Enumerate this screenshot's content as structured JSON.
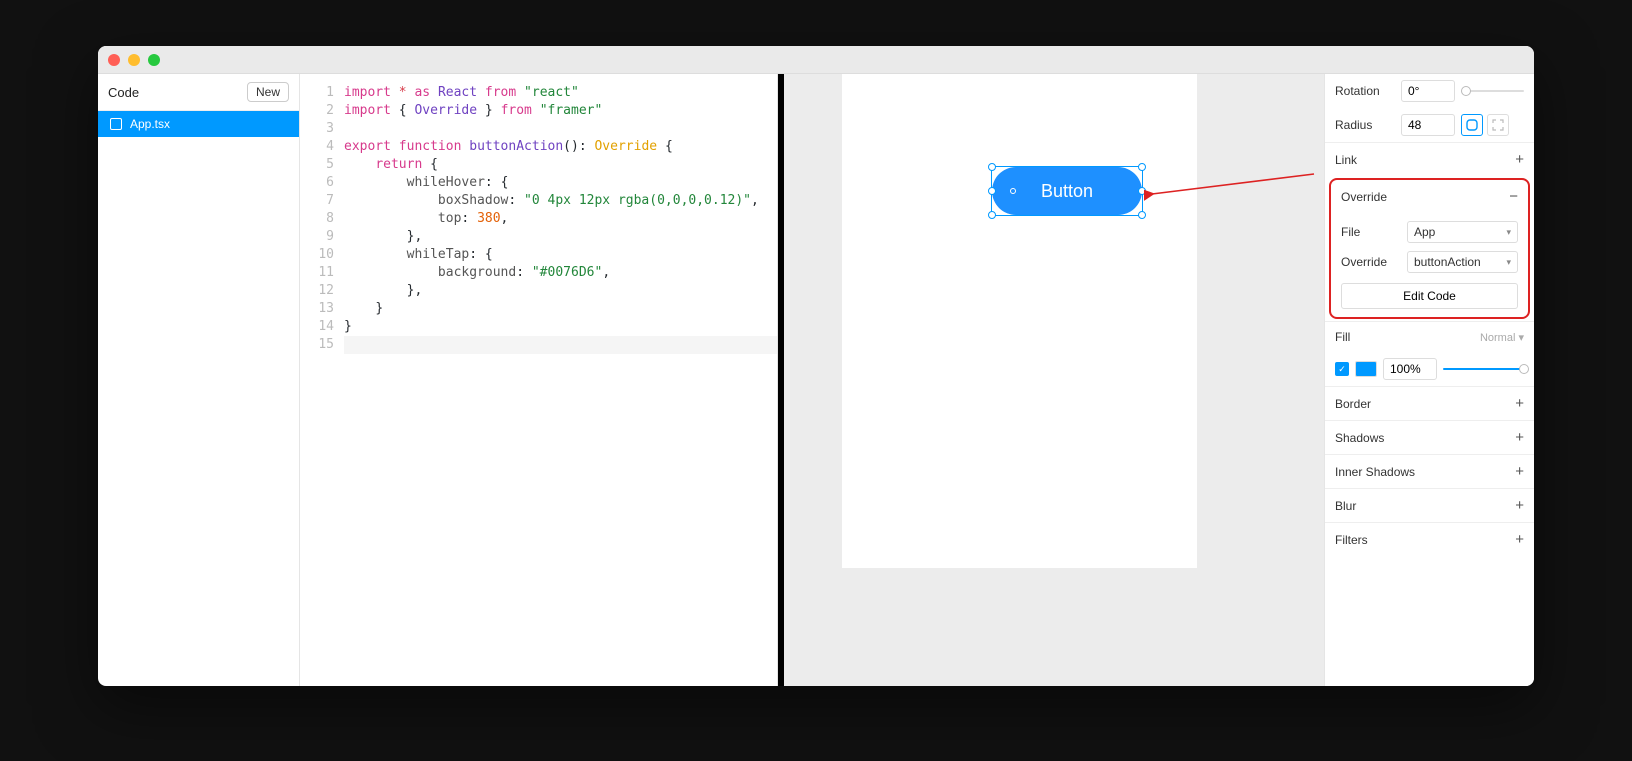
{
  "sidebar": {
    "title": "Code",
    "new_btn": "New",
    "file_name": "App.tsx"
  },
  "canvas": {
    "button_label": "Button"
  },
  "code": {
    "line_numbers": [
      "1",
      "2",
      "3",
      "4",
      "5",
      "6",
      "7",
      "8",
      "9",
      "10",
      "11",
      "12",
      "13",
      "14",
      "15"
    ],
    "tokens": {
      "import": "import",
      "star": "*",
      "as": "as",
      "react": "React",
      "from": "from",
      "react_str": "\"react\"",
      "lbrace": "{",
      "rbrace": "}",
      "override_ident": "Override",
      "framer_str": "\"framer\"",
      "export": "export",
      "function": "function",
      "fn_name": "buttonAction",
      "parens": "()",
      "colon": ":",
      "override_type": "Override",
      "return": "return",
      "whileHover": "whileHover",
      "boxShadow": "boxShadow",
      "boxShadow_val": "\"0 4px 12px rgba(0,0,0,0.12)\"",
      "top": "top",
      "top_val": "380",
      "comma": ",",
      "whileTap": "whileTap",
      "background": "background",
      "background_val": "\"#0076D6\""
    }
  },
  "props": {
    "rotation_label": "Rotation",
    "rotation_value": "0°",
    "radius_label": "Radius",
    "radius_value": "48",
    "link_label": "Link",
    "override_label": "Override",
    "file_label": "File",
    "file_value": "App",
    "override_field_label": "Override",
    "override_value": "buttonAction",
    "edit_code": "Edit Code",
    "fill_label": "Fill",
    "fill_mode": "Normal",
    "fill_value": "100%",
    "fill_color": "#0099FF",
    "border_label": "Border",
    "shadows_label": "Shadows",
    "inner_shadows_label": "Inner Shadows",
    "blur_label": "Blur",
    "filters_label": "Filters"
  }
}
